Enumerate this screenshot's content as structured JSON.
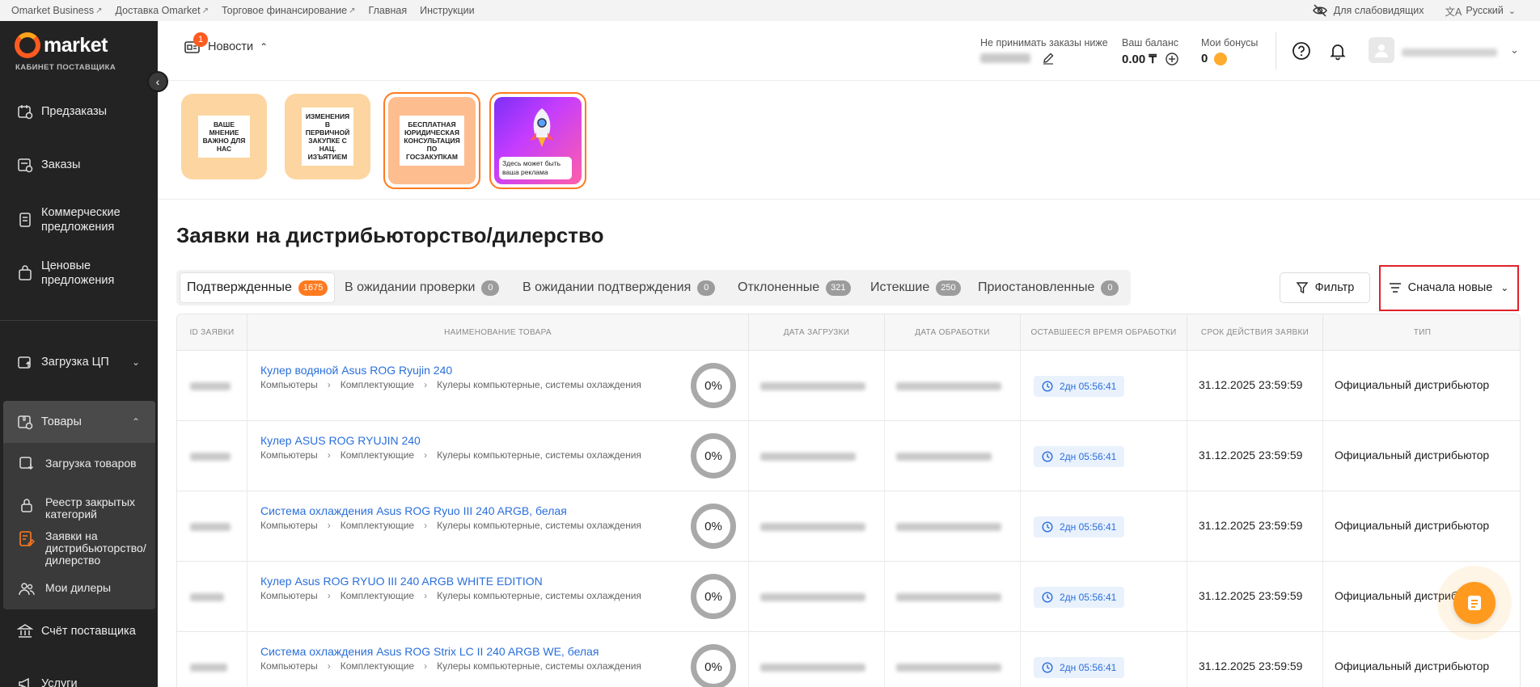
{
  "topbar": {
    "links": [
      "Omarket Business",
      "Доставка Omarket",
      "Торговое финансирование",
      "Главная",
      "Инструкции"
    ],
    "accessibility": "Для слабовидящих",
    "language": "Русский"
  },
  "sidebar": {
    "logo": "market",
    "subtitle": "КАБИНЕТ ПОСТАВЩИКА",
    "items": [
      {
        "label": "Предзаказы"
      },
      {
        "label": "Заказы"
      },
      {
        "label": "Коммерческие предложения"
      },
      {
        "label": "Ценовые предложения"
      },
      {
        "label": "Загрузка ЦП"
      },
      {
        "label": "Товары"
      },
      {
        "label": "Счёт поставщика"
      },
      {
        "label": "Услуги"
      }
    ],
    "subitems": [
      {
        "label": "Загрузка товаров"
      },
      {
        "label": "Реестр закрытых категорий"
      },
      {
        "label": "Заявки на дистрибьюторство/ дилерство"
      },
      {
        "label": "Мои дилеры"
      }
    ]
  },
  "header": {
    "news_label": "Новости",
    "news_badge": "1",
    "min_order_label": "Не принимать заказы ниже",
    "balance_label": "Ваш баланс",
    "balance_value": "0.00 ₸",
    "bonus_label": "Мои бонусы",
    "bonus_value": "0"
  },
  "banners": [
    {
      "text": "ВАШЕ МНЕНИЕ ВАЖНО ДЛЯ НАС"
    },
    {
      "text": "ИЗМЕНЕНИЯ В ПЕРВИЧНОЙ ЗАКУПКЕ С НАЦ. ИЗЪЯТИЕМ"
    },
    {
      "text": "БЕСПЛАТНАЯ ЮРИДИЧЕСКАЯ КОНСУЛЬТАЦИЯ ПО ГОСЗАКУПКАМ"
    },
    {
      "text": "Здесь может быть ваша реклама"
    }
  ],
  "page": {
    "title": "Заявки на дистрибьюторство/дилерство",
    "filter_label": "Фильтр",
    "sort_label": "Сначала новые"
  },
  "tabs": [
    {
      "label": "Подтвержденные",
      "count": "1675"
    },
    {
      "label": "В ожидании проверки",
      "count": "0"
    },
    {
      "label": "В ожидании подтверждения",
      "count": "0"
    },
    {
      "label": "Отклоненные",
      "count": "321"
    },
    {
      "label": "Истекшие",
      "count": "250"
    },
    {
      "label": "Приостановленные",
      "count": "0"
    }
  ],
  "table": {
    "columns": [
      "ID ЗАЯВКИ",
      "НАИМЕНОВАНИЕ ТОВАРА",
      "ДАТА ЗАГРУЗКИ",
      "ДАТА ОБРАБОТКИ",
      "ОСТАВШЕЕСЯ ВРЕМЯ ОБРАБОТКИ",
      "СРОК ДЕЙСТВИЯ ЗАЯВКИ",
      "ТИП"
    ],
    "rows": [
      {
        "name": "Кулер водяной Asus ROG Ryujin 240",
        "c1": "Компьютеры",
        "c2": "Комплектующие",
        "c3": "Кулеры компьютерные, системы охлаждения",
        "pct": "0%",
        "remain": "2дн 05:56:41",
        "expiry": "31.12.2025 23:59:59",
        "type": "Официальный дистрибьютор"
      },
      {
        "name": "Кулер ASUS ROG RYUJIN 240",
        "c1": "Компьютеры",
        "c2": "Комплектующие",
        "c3": "Кулеры компьютерные, системы охлаждения",
        "pct": "0%",
        "remain": "2дн 05:56:41",
        "expiry": "31.12.2025 23:59:59",
        "type": "Официальный дистрибьютор"
      },
      {
        "name": "Система охлаждения Asus ROG Ryuo III 240 ARGB, белая",
        "c1": "Компьютеры",
        "c2": "Комплектующие",
        "c3": "Кулеры компьютерные, системы охлаждения",
        "pct": "0%",
        "remain": "2дн 05:56:41",
        "expiry": "31.12.2025 23:59:59",
        "type": "Официальный дистрибьютор"
      },
      {
        "name": "Кулер Asus ROG RYUO III 240 ARGB WHITE EDITION",
        "c1": "Компьютеры",
        "c2": "Комплектующие",
        "c3": "Кулеры компьютерные, системы охлаждения",
        "pct": "0%",
        "remain": "2дн 05:56:41",
        "expiry": "31.12.2025 23:59:59",
        "type": "Официальный дистрибь"
      },
      {
        "name": "Система охлаждения Asus ROG Strix LC II 240 ARGB WE, белая",
        "c1": "Компьютеры",
        "c2": "Комплектующие",
        "c3": "Кулеры компьютерные, системы охлаждения",
        "pct": "0%",
        "remain": "2дн 05:56:41",
        "expiry": "31.12.2025 23:59:59",
        "type": "Официальный дистрибьютор"
      }
    ]
  }
}
